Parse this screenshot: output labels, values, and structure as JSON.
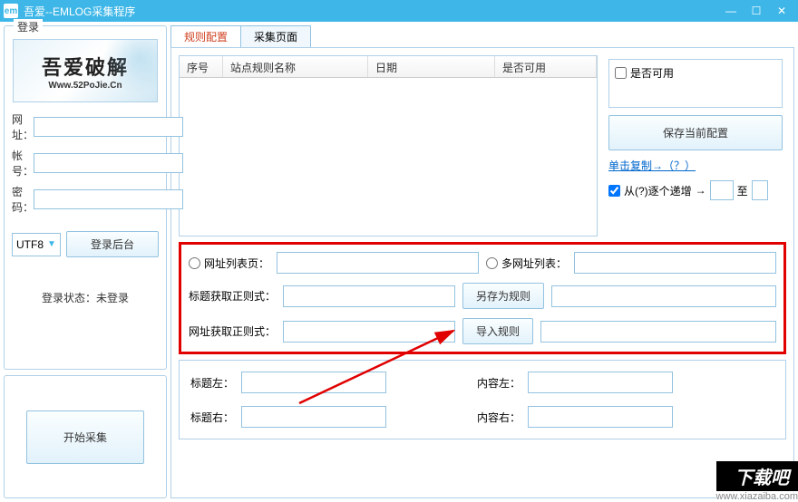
{
  "window": {
    "icon_text": "em",
    "title": "吾爱--EMLOG采集程序",
    "min": "—",
    "max": "☐",
    "close": "✕"
  },
  "login": {
    "legend": "登录",
    "logo_line1": "吾爱破解",
    "logo_line2": "Www.52PoJie.Cn",
    "url_label": "网址：",
    "url_value": "",
    "account_label": "帐号：",
    "account_value": "",
    "password_label": "密码：",
    "password_value": "",
    "encoding": "UTF8",
    "login_btn": "登录后台",
    "status_label": "登录状态：",
    "status_value": "未登录",
    "start_btn": "开始采集"
  },
  "tabs": {
    "rule_config": "规则配置",
    "collect_page": "采集页面"
  },
  "table": {
    "col_seq": "序号",
    "col_rule_name": "站点规则名称",
    "col_date": "日期",
    "col_enabled": "是否可用"
  },
  "side": {
    "enabled_chk": "是否可用",
    "save_config_btn": "保存当前配置",
    "copy_link": "单击复制→（？）",
    "increment_chk": "从(?)逐个递增",
    "arrow": "→",
    "to_label": "至",
    "from_value": "",
    "to_value": ""
  },
  "redframe": {
    "radio_list_page": "网址列表页：",
    "list_page_value": "",
    "radio_multi_list": "多网址列表：",
    "multi_list_value": "",
    "title_regex_label": "标题获取正则式：",
    "title_regex_value": "",
    "save_as_rule_btn": "另存为规则",
    "url_regex_label": "网址获取正则式：",
    "url_regex_value": "",
    "import_rule_btn": "导入规则",
    "extra1_value": "",
    "extra2_value": ""
  },
  "bottom": {
    "title_left_label": "标题左：",
    "title_left_value": "",
    "content_left_label": "内容左：",
    "content_left_value": "",
    "title_right_label": "标题右：",
    "title_right_value": "",
    "content_right_label": "内容右：",
    "content_right_value": ""
  },
  "watermark": {
    "text1": "下载吧",
    "text2": "www.xiazaiba.com"
  }
}
